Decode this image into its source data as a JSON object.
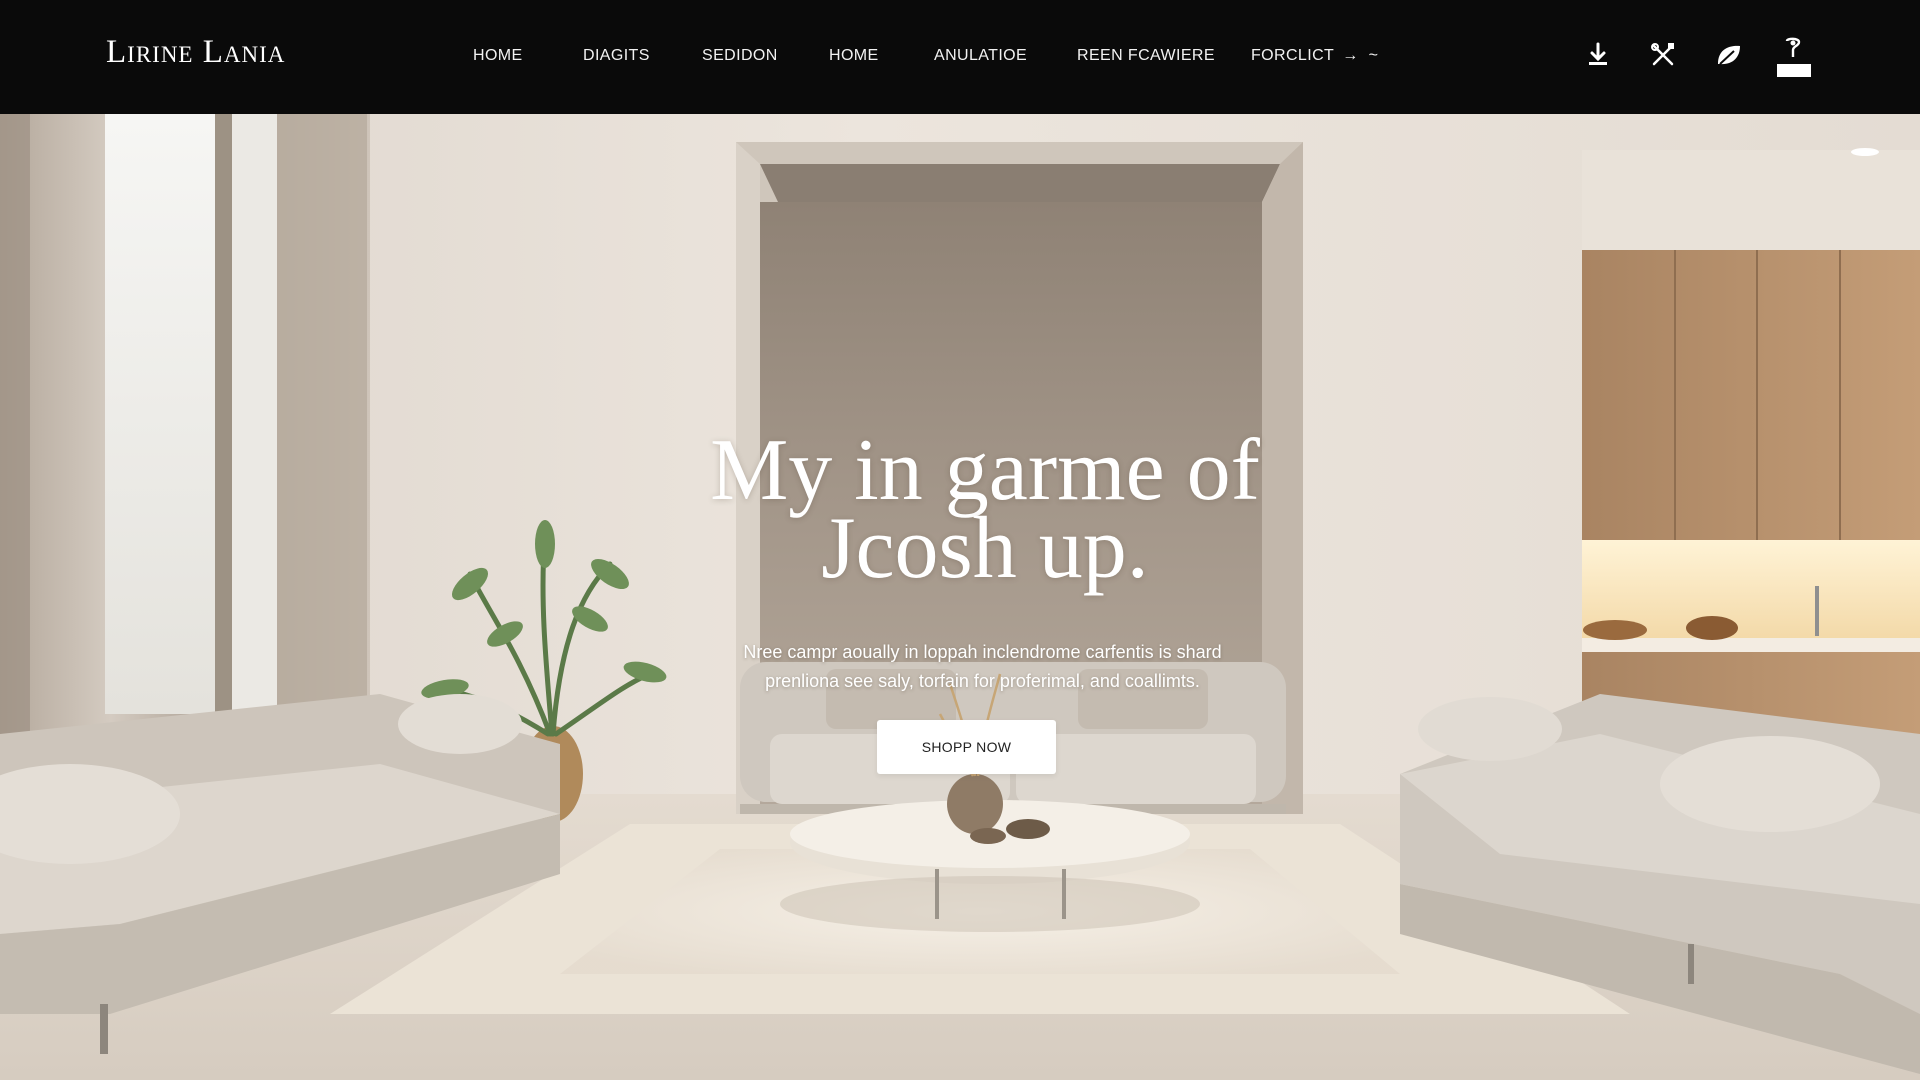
{
  "brand": {
    "logo": "Lirine Lania"
  },
  "nav": {
    "items": [
      {
        "label": "HOME"
      },
      {
        "label": "DIAGITS"
      },
      {
        "label": "SEDIDON"
      },
      {
        "label": "HOME"
      },
      {
        "label": "ANULATIOE"
      },
      {
        "label": "REEN FCAWIERE"
      },
      {
        "label": "FORCLICT"
      }
    ],
    "last_item_arrow": "→",
    "last_item_suffix": "~",
    "icons": [
      "download-icon",
      "tools-icon",
      "leaf-icon",
      "cart-icon"
    ]
  },
  "hero": {
    "headline_line1": "My in garme of",
    "headline_line2": "Jcosh up.",
    "subtext_line1": "Nree campr aoually in loppah inclendrome carfentis is shard",
    "subtext_line2": "prenliona see saly, torfain for proferimal, and coallimts.",
    "cta_label": "SHOPP NOW"
  },
  "colors": {
    "nav_bg": "#0a0a0a",
    "wall": "#ede6de",
    "alcove": "#a89a8c",
    "wood": "#b8926c",
    "sofa": "#d9d4cc",
    "rug": "#ebe3d6"
  }
}
